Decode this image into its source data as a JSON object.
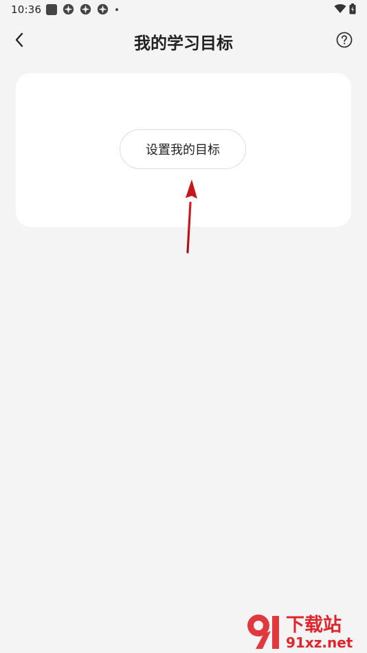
{
  "status_bar": {
    "time": "10:36",
    "icons": [
      "app-square-icon",
      "app-flower-icon",
      "app-flower-icon",
      "app-flower-icon",
      "notification-dot-icon"
    ],
    "right_icons": [
      "wifi-icon",
      "battery-icon"
    ]
  },
  "header": {
    "title": "我的学习目标",
    "back_icon": "chevron-left-icon",
    "help_icon": "help-circle-icon"
  },
  "card": {
    "button_label": "设置我的目标"
  },
  "watermark": {
    "text_top": "下载站",
    "text_bottom": "91xz.net"
  },
  "colors": {
    "background": "#f4f4f4",
    "card": "#ffffff",
    "arrow": "#c8161d",
    "watermark": "#e0242b"
  }
}
